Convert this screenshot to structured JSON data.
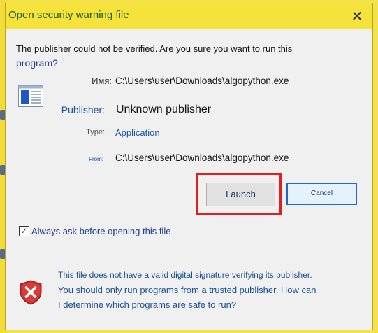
{
  "dialog": {
    "title": "Open security warning file",
    "close_glyph": "✕"
  },
  "question": {
    "line1": "The publisher could not be verified. Are you sure you want to run this",
    "line2": "program?"
  },
  "fields": {
    "name_label": "Имя:",
    "name_value": "C:\\Users\\user\\Downloads\\algopython.exe",
    "publisher_label": "Publisher:",
    "publisher_value": "Unknown publisher",
    "type_label": "Type:",
    "type_value": "Application",
    "from_label": "From:",
    "from_value": "C:\\Users\\user\\Downloads\\algopython.exe"
  },
  "buttons": {
    "launch": "Launch",
    "cancel": "Cancel"
  },
  "checkbox": {
    "checked": true,
    "mark": "✓",
    "label": "Always ask before opening this file"
  },
  "warning": {
    "line1": "This file does not have a valid digital signature verifying its publisher.",
    "line2_prefix": "You should only run programs from a trusted publisher. ",
    "line2_link": "How can",
    "line3_link": "I determine which programs are safe to run?"
  },
  "icons": {
    "file": "application-window-icon",
    "warning": "shield-error-icon"
  },
  "colors": {
    "highlight": "#e02020",
    "title_bar": "#f5e23a",
    "link": "#1a50a0"
  }
}
